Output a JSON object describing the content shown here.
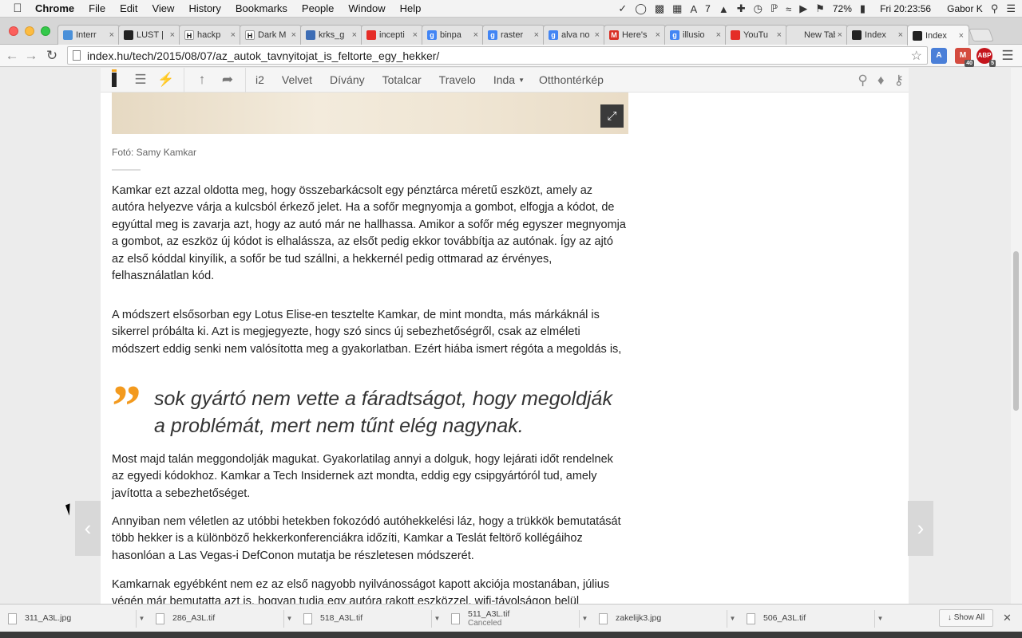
{
  "menubar": {
    "app": "Chrome",
    "items": [
      "File",
      "Edit",
      "View",
      "History",
      "Bookmarks",
      "People",
      "Window",
      "Help"
    ],
    "status": {
      "battery": "72%",
      "clock": "Fri 20:23:56",
      "user": "Gabor K",
      "badge_count": "7"
    }
  },
  "tabs": [
    {
      "title": "Interr",
      "fav_color": "#4a90d9",
      "fav_glyph": ""
    },
    {
      "title": "LUST |",
      "fav_color": "#222222",
      "fav_glyph": ""
    },
    {
      "title": "hackp",
      "fav_color": "#ffffff",
      "fav_glyph": "H"
    },
    {
      "title": "Dark M",
      "fav_color": "#ffffff",
      "fav_glyph": "H"
    },
    {
      "title": "krks_g",
      "fav_color": "#3d6db5",
      "fav_glyph": ""
    },
    {
      "title": "incepti",
      "fav_color": "#e52d27",
      "fav_glyph": ""
    },
    {
      "title": "binpa",
      "fav_color": "#4285f4",
      "fav_glyph": "g"
    },
    {
      "title": "raster",
      "fav_color": "#4285f4",
      "fav_glyph": "g"
    },
    {
      "title": "alva no",
      "fav_color": "#4285f4",
      "fav_glyph": "g"
    },
    {
      "title": "Here's",
      "fav_color": "#d93025",
      "fav_glyph": "M"
    },
    {
      "title": "illusio",
      "fav_color": "#4285f4",
      "fav_glyph": "g"
    },
    {
      "title": "YouTu",
      "fav_color": "#e52d27",
      "fav_glyph": ""
    },
    {
      "title": "New Tab",
      "fav_color": "",
      "fav_glyph": ""
    },
    {
      "title": "Index",
      "fav_color": "#222222",
      "fav_glyph": ""
    },
    {
      "title": "Index",
      "fav_color": "#222222",
      "fav_glyph": "",
      "active": true
    }
  ],
  "omnibox": {
    "url": "index.hu/tech/2015/08/07/az_autok_tavnyitojat_is_feltorte_egy_hekker/"
  },
  "extensions": {
    "gmail_count": "40",
    "abp_label": "ABP",
    "abp_count": "5"
  },
  "sitenav": {
    "links": [
      "i2",
      "Velvet",
      "Dívány",
      "Totalcar",
      "Travelo",
      "Inda",
      "Otthontérkép"
    ]
  },
  "article": {
    "caption": "Fotó: Samy Kamkar",
    "p1": "Kamkar ezt azzal oldotta meg, hogy összebarkácsolt egy pénztárca méretű eszközt, amely az autóra helyezve várja a kulcsból érkező jelet. Ha a sofőr megnyomja a gombot, elfogja a kódot, de egyúttal meg is zavarja azt, hogy az autó már ne hallhassa. Amikor a sofőr még egyszer megnyomja a gombot, az eszköz új kódot is elhalássza, az elsőt pedig ekkor továbbítja az autónak. Így az ajtó az első kóddal kinyílik, a sofőr be tud szállni, a hekkernél pedig ottmarad az érvényes, felhasználatlan kód.",
    "p2": "A módszert elsősorban egy Lotus Elise-en tesztelte Kamkar, de mint mondta, más márkáknál is sikerrel próbálta ki. Azt is megjegyezte, hogy szó sincs új sebezhetőségről, csak az elméleti módszert eddig senki nem valósította meg a gyakorlatban. Ezért hiába ismert régóta a megoldás is,",
    "quote": "sok gyártó nem vette a fáradtságot, hogy megoldják a problémát, mert nem tűnt elég nagynak.",
    "p3": "Most majd talán meggondolják magukat. Gyakorlatilag annyi a dolguk, hogy lejárati időt rendelnek az egyedi kódokhoz. Kamkar a Tech Insidernek azt mondta, eddig egy csipgyártóról tud, amely javította a sebezhetőséget.",
    "p4": "Annyiban nem véletlen az utóbbi hetekben fokozódó autóhekkelési láz, hogy a trükkök bemutatását több hekker is a különböző hekkerkonferenciákra időzíti, Kamkar a Teslát feltörő kollégáihoz hasonlóan a Las Vegas-i DefConon mutatja be részletesen módszerét.",
    "p5": "Kamkarnak egyébként nem ez az első nagyobb nyilvánosságot kapott akciója mostanában, július végén már bemutatta azt is, hogyan tudja egy autóra rakott eszközzel, wifi-távolságon belül"
  },
  "downloads": [
    {
      "name": "311_A3L.jpg",
      "status": ""
    },
    {
      "name": "286_A3L.tif",
      "status": ""
    },
    {
      "name": "518_A3L.tif",
      "status": ""
    },
    {
      "name": "511_A3L.tif",
      "status": "Canceled"
    },
    {
      "name": "zakelijk3.jpg",
      "status": ""
    },
    {
      "name": "506_A3L.tif",
      "status": ""
    }
  ],
  "shelf": {
    "show_all": "Show All"
  },
  "colors": {
    "quote_mark": "#f39a1e",
    "site_accent": "#f4a61d"
  }
}
